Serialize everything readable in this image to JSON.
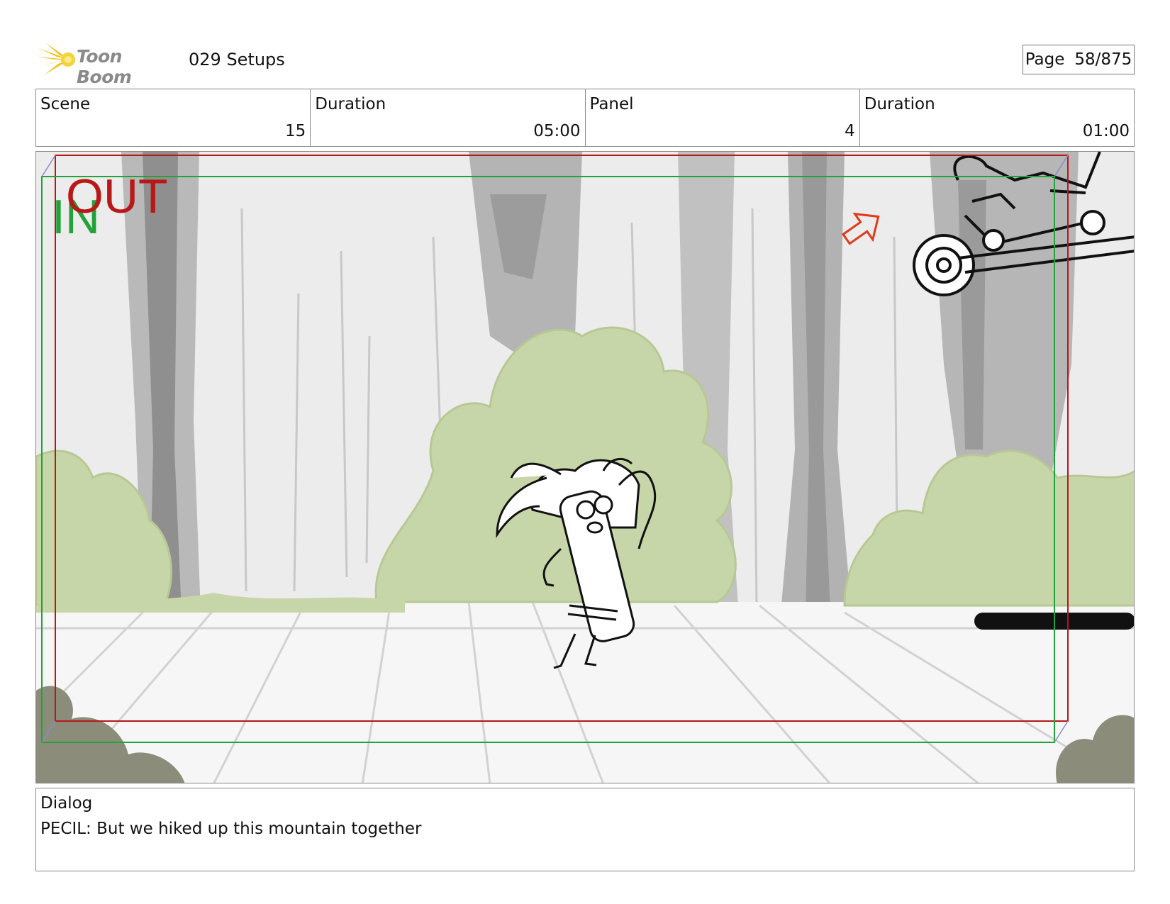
{
  "header": {
    "logo_text": "Toon Boom",
    "project_title": "029 Setups",
    "page_label": "Page",
    "page_value": "58/875"
  },
  "info": {
    "scene_label": "Scene",
    "scene_value": "15",
    "scene_duration_label": "Duration",
    "scene_duration_value": "05:00",
    "panel_label": "Panel",
    "panel_value": "4",
    "panel_duration_label": "Duration",
    "panel_duration_value": "01:00"
  },
  "panel_markers": {
    "in_label": "IN",
    "out_label": "OUT",
    "in_color": "#22a33a",
    "out_color": "#b81818",
    "arrow_color": "#e23a1a"
  },
  "dialog": {
    "label": "Dialog",
    "text": "PECIL: But we hiked up this mountain together"
  }
}
